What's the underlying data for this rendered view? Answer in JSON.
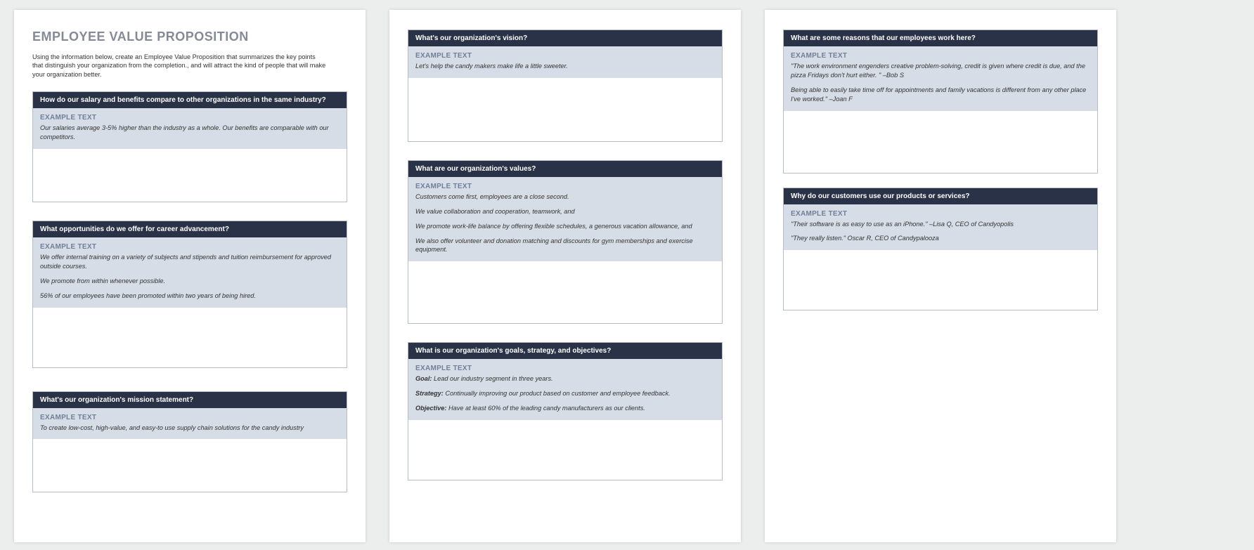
{
  "title": "EMPLOYEE VALUE PROPOSITION",
  "intro": "Using the information below, create an Employee Value Proposition that summarizes the key points that distinguish your organization from the completion., and will attract the kind of people that will make your organization better.",
  "example_label": "EXAMPLE TEXT",
  "sections": {
    "salary": {
      "question": "How do our salary and benefits compare to other organizations in the same industry?",
      "lines": [
        "Our salaries average 3-5% higher than the industry as a whole. Our benefits are comparable with our competitors."
      ]
    },
    "career": {
      "question": "What opportunities do we offer for career advancement?",
      "lines": [
        "We offer internal training on a variety of subjects and stipends and tuition reimbursement for approved outside courses.",
        "We promote from within whenever possible.",
        "56% of our employees have been promoted within two years of being hired."
      ]
    },
    "mission": {
      "question": "What's our organization's mission statement?",
      "lines": [
        "To create low-cost, high-value, and easy-to use supply chain solutions for the candy industry"
      ]
    },
    "vision": {
      "question": "What's our organization's vision?",
      "lines": [
        "Let's help the candy makers make life a little sweeter."
      ]
    },
    "values": {
      "question": "What are our organization's values?",
      "lines": [
        "Customers come first, employees are a close second.",
        "We value collaboration and cooperation, teamwork, and",
        "We promote work-life balance by offering flexible schedules, a generous vacation allowance, and",
        "We also offer volunteer and donation matching and discounts for gym memberships and exercise equipment."
      ]
    },
    "goals": {
      "question": "What is our organization's goals, strategy, and objectives?",
      "kv": [
        {
          "k": "Goal:",
          "v": " Lead our industry segment in three years."
        },
        {
          "k": "Strategy:",
          "v": " Continually improving our product based on customer and employee feedback."
        },
        {
          "k": "Objective:",
          "v": " Have at least 60% of the leading candy manufacturers as our clients."
        }
      ]
    },
    "reasons": {
      "question": "What are some reasons that our employees work here?",
      "lines": [
        "\"The work environment engenders creative problem-solving, credit is given where credit is due, and the pizza Fridays don't hurt either. \" –Bob S",
        "Being able to easily take time off for appointments and family vacations is different from any other place I've worked.\" –Joan F"
      ]
    },
    "customers": {
      "question": "Why do our customers use our products or services?",
      "lines": [
        "\"Their software is as easy to use as an iPhone.\" –Lisa Q, CEO of Candyopolis",
        "\"They really listen.\" Oscar R, CEO of Candypalooza"
      ]
    }
  }
}
